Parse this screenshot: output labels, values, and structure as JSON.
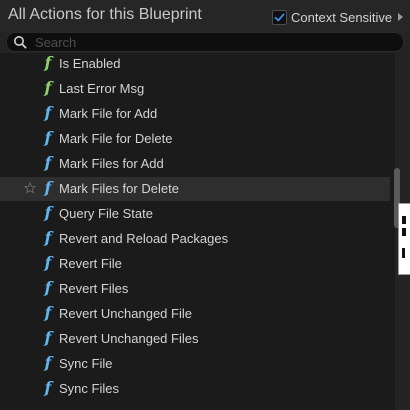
{
  "header": {
    "title": "All Actions for this Blueprint",
    "context_sensitive_label": "Context Sensitive",
    "context_sensitive_checked": true
  },
  "search": {
    "placeholder": "Search",
    "value": ""
  },
  "list": {
    "items": [
      {
        "label": "Is Enabled",
        "icon": "function-icon",
        "color": "#8fd36b"
      },
      {
        "label": "Last Error Msg",
        "icon": "function-icon",
        "color": "#8fd36b"
      },
      {
        "label": "Mark File for Add",
        "icon": "function-icon",
        "color": "#5fb6f0"
      },
      {
        "label": "Mark File for Delete",
        "icon": "function-icon",
        "color": "#5fb6f0"
      },
      {
        "label": "Mark Files for Add",
        "icon": "function-icon",
        "color": "#5fb6f0"
      },
      {
        "label": "Mark Files for Delete",
        "icon": "function-icon",
        "color": "#5fb6f0",
        "hovered": true
      },
      {
        "label": "Query File State",
        "icon": "function-icon",
        "color": "#5fb6f0"
      },
      {
        "label": "Revert and Reload Packages",
        "icon": "function-icon",
        "color": "#5fb6f0"
      },
      {
        "label": "Revert File",
        "icon": "function-icon",
        "color": "#5fb6f0"
      },
      {
        "label": "Revert Files",
        "icon": "function-icon",
        "color": "#5fb6f0"
      },
      {
        "label": "Revert Unchanged File",
        "icon": "function-icon",
        "color": "#5fb6f0"
      },
      {
        "label": "Revert Unchanged Files",
        "icon": "function-icon",
        "color": "#5fb6f0"
      },
      {
        "label": "Sync File",
        "icon": "function-icon",
        "color": "#5fb6f0"
      },
      {
        "label": "Sync Files",
        "icon": "function-icon",
        "color": "#5fb6f0"
      }
    ],
    "function_glyph": "f"
  },
  "colors": {
    "accent_check": "#3b8ee8",
    "function_pure": "#8fd36b",
    "function_impure": "#5fb6f0"
  }
}
